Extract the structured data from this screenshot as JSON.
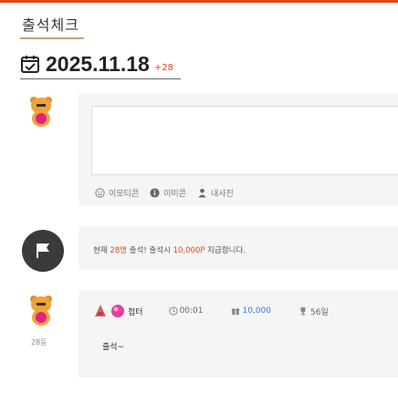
{
  "header": {
    "title": "출석체크"
  },
  "date": {
    "value": "2025.11.18",
    "delta": "+28"
  },
  "composer": {
    "tools": [
      {
        "icon": "smile-icon",
        "label": "이모티콘"
      },
      {
        "icon": "info-icon",
        "label": "이미콘"
      },
      {
        "icon": "user-icon",
        "label": "내사진"
      }
    ]
  },
  "notice": {
    "prefix": "현재 ",
    "count": "28명",
    "mid": " 출석! 출석시 ",
    "points": "10,000P",
    "suffix": " 지급합니다."
  },
  "entry": {
    "name": "첩터",
    "time": "00:01",
    "points": "10,000",
    "days": "56일",
    "rank": "28등",
    "comment": "출석~"
  },
  "colors": {
    "accent": "#e8461e",
    "points_blue": "#2f7bd9"
  }
}
